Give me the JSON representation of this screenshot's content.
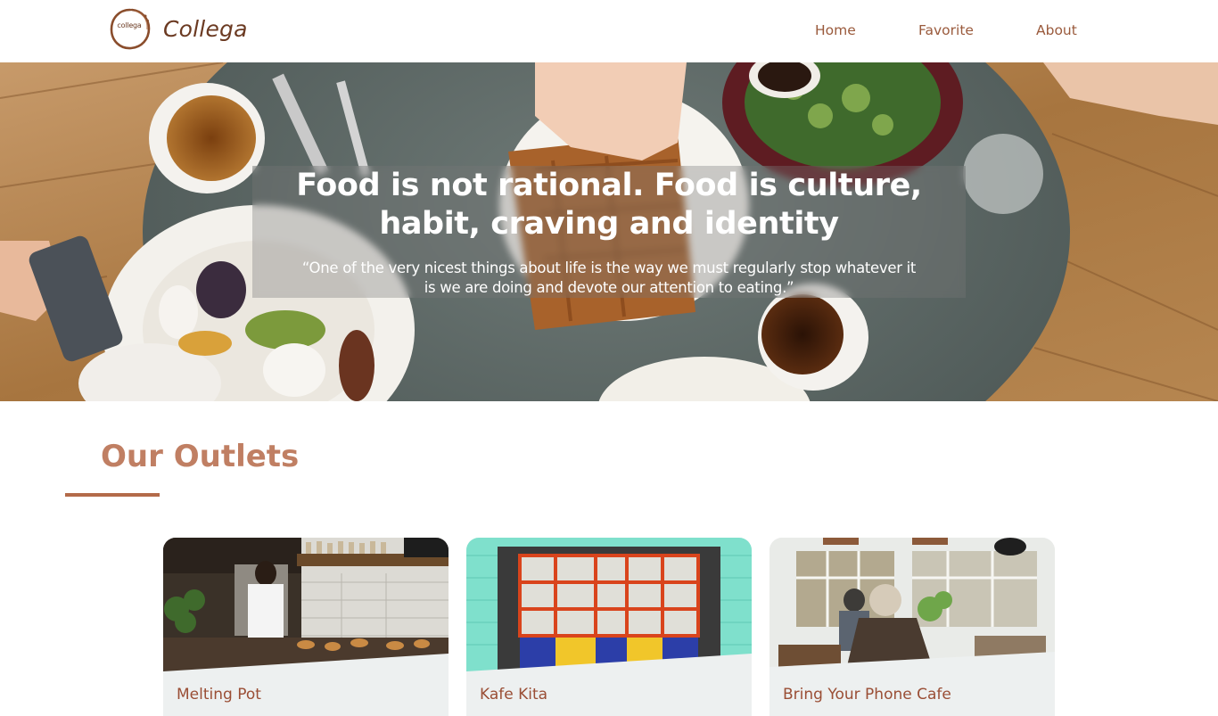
{
  "brand": {
    "logo_text": "collega",
    "name": "Collega",
    "colors": {
      "primary": "#6b3a22",
      "accent": "#b36a49"
    }
  },
  "nav": {
    "home": "Home",
    "favorite": "Favorite",
    "about": "About"
  },
  "hero": {
    "title_line1": "Food is not rational. Food is culture,",
    "title_line2": "habit, craving and identity",
    "quote_line1": "“One of the very nicest things about life is the way we must regularly stop whatever it",
    "quote_line2": "is we are doing and devote our attention to eating.”"
  },
  "outlets": {
    "heading": "Our Outlets",
    "cards": [
      {
        "title": "Melting Pot",
        "image_icon": "cafe-kitchen-photo"
      },
      {
        "title": "Kafe Kita",
        "image_icon": "storefront-photo"
      },
      {
        "title": "Bring Your Phone Cafe",
        "image_icon": "cafe-interior-photo"
      }
    ]
  }
}
